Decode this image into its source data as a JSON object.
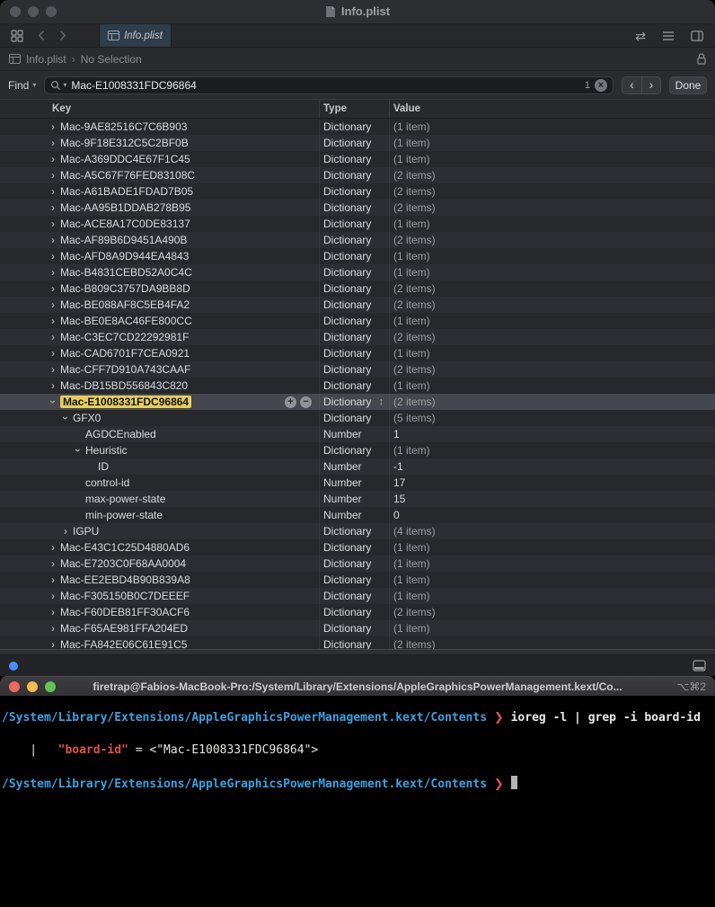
{
  "icons": {
    "disclosure": "›",
    "stepper": "↕",
    "clear": "×",
    "prev": "‹",
    "next": "›",
    "dropdown": "▾",
    "crumb_separator": "›",
    "swap_editors": "⇄",
    "add": "+",
    "remove": "−"
  },
  "colors": {
    "find_highlight": "#e6cd60",
    "selected_row": "#44484e",
    "terminal_path_blue": "#3da1e0",
    "terminal_red": "#de524d",
    "terminal_background": "#000000",
    "status_dot_blue": "#4d8df6"
  },
  "xcode": {
    "window_title": "Info.plist",
    "tab_title": "Info.plist",
    "jumpbar": {
      "file": "Info.plist",
      "selection": "No Selection"
    },
    "findbar": {
      "mode_label": "Find",
      "query": "Mac-E1008331FDC96864",
      "match_count": "1",
      "done_label": "Done"
    },
    "columns": {
      "key": "Key",
      "type": "Type",
      "value": "Value"
    },
    "rows": [
      {
        "key": "Mac-9AE82516C7C6B903",
        "type": "Dictionary",
        "value": "(1 item)",
        "indent": 0,
        "disclosure": "collapsed"
      },
      {
        "key": "Mac-9F18E312C5C2BF0B",
        "type": "Dictionary",
        "value": "(1 item)",
        "indent": 0,
        "disclosure": "collapsed"
      },
      {
        "key": "Mac-A369DDC4E67F1C45",
        "type": "Dictionary",
        "value": "(1 item)",
        "indent": 0,
        "disclosure": "collapsed"
      },
      {
        "key": "Mac-A5C67F76FED83108C",
        "type": "Dictionary",
        "value": "(2 items)",
        "indent": 0,
        "disclosure": "collapsed"
      },
      {
        "key": "Mac-A61BADE1FDAD7B05",
        "type": "Dictionary",
        "value": "(2 items)",
        "indent": 0,
        "disclosure": "collapsed"
      },
      {
        "key": "Mac-AA95B1DDAB278B95",
        "type": "Dictionary",
        "value": "(2 items)",
        "indent": 0,
        "disclosure": "collapsed"
      },
      {
        "key": "Mac-ACE8A17C0DE83137",
        "type": "Dictionary",
        "value": "(1 item)",
        "indent": 0,
        "disclosure": "collapsed"
      },
      {
        "key": "Mac-AF89B6D9451A490B",
        "type": "Dictionary",
        "value": "(2 items)",
        "indent": 0,
        "disclosure": "collapsed"
      },
      {
        "key": "Mac-AFD8A9D944EA4843",
        "type": "Dictionary",
        "value": "(1 item)",
        "indent": 0,
        "disclosure": "collapsed"
      },
      {
        "key": "Mac-B4831CEBD52A0C4C",
        "type": "Dictionary",
        "value": "(1 item)",
        "indent": 0,
        "disclosure": "collapsed"
      },
      {
        "key": "Mac-B809C3757DA9BB8D",
        "type": "Dictionary",
        "value": "(2 items)",
        "indent": 0,
        "disclosure": "collapsed"
      },
      {
        "key": "Mac-BE088AF8C5EB4FA2",
        "type": "Dictionary",
        "value": "(2 items)",
        "indent": 0,
        "disclosure": "collapsed"
      },
      {
        "key": "Mac-BE0E8AC46FE800CC",
        "type": "Dictionary",
        "value": "(1 item)",
        "indent": 0,
        "disclosure": "collapsed"
      },
      {
        "key": "Mac-C3EC7CD22292981F",
        "type": "Dictionary",
        "value": "(2 items)",
        "indent": 0,
        "disclosure": "collapsed"
      },
      {
        "key": "Mac-CAD6701F7CEA0921",
        "type": "Dictionary",
        "value": "(1 item)",
        "indent": 0,
        "disclosure": "collapsed"
      },
      {
        "key": "Mac-CFF7D910A743CAAF",
        "type": "Dictionary",
        "value": "(2 items)",
        "indent": 0,
        "disclosure": "collapsed"
      },
      {
        "key": "Mac-DB15BD556843C820",
        "type": "Dictionary",
        "value": "(1 item)",
        "indent": 0,
        "disclosure": "collapsed"
      },
      {
        "key": "Mac-E1008331FDC96864",
        "type": "Dictionary",
        "value": "(2 items)",
        "indent": 0,
        "disclosure": "expanded",
        "selected": true,
        "highlighted": true
      },
      {
        "key": "GFX0",
        "type": "Dictionary",
        "value": "(5 items)",
        "indent": 1,
        "disclosure": "expanded"
      },
      {
        "key": "AGDCEnabled",
        "type": "Number",
        "value": "1",
        "indent": 2,
        "disclosure": "none"
      },
      {
        "key": "Heuristic",
        "type": "Dictionary",
        "value": "(1 item)",
        "indent": 2,
        "disclosure": "expanded"
      },
      {
        "key": "ID",
        "type": "Number",
        "value": "-1",
        "indent": 3,
        "disclosure": "none"
      },
      {
        "key": "control-id",
        "type": "Number",
        "value": "17",
        "indent": 2,
        "disclosure": "none"
      },
      {
        "key": "max-power-state",
        "type": "Number",
        "value": "15",
        "indent": 2,
        "disclosure": "none"
      },
      {
        "key": "min-power-state",
        "type": "Number",
        "value": "0",
        "indent": 2,
        "disclosure": "none"
      },
      {
        "key": "IGPU",
        "type": "Dictionary",
        "value": "(4 items)",
        "indent": 1,
        "disclosure": "collapsed"
      },
      {
        "key": "Mac-E43C1C25D4880AD6",
        "type": "Dictionary",
        "value": "(1 item)",
        "indent": 0,
        "disclosure": "collapsed"
      },
      {
        "key": "Mac-E7203C0F68AA0004",
        "type": "Dictionary",
        "value": "(1 item)",
        "indent": 0,
        "disclosure": "collapsed"
      },
      {
        "key": "Mac-EE2EBD4B90B839A8",
        "type": "Dictionary",
        "value": "(1 item)",
        "indent": 0,
        "disclosure": "collapsed"
      },
      {
        "key": "Mac-F305150B0C7DEEEF",
        "type": "Dictionary",
        "value": "(1 item)",
        "indent": 0,
        "disclosure": "collapsed"
      },
      {
        "key": "Mac-F60DEB81FF30ACF6",
        "type": "Dictionary",
        "value": "(2 items)",
        "indent": 0,
        "disclosure": "collapsed"
      },
      {
        "key": "Mac-F65AE981FFA204ED",
        "type": "Dictionary",
        "value": "(1 item)",
        "indent": 0,
        "disclosure": "collapsed"
      },
      {
        "key": "Mac-FA842E06C61E91C5",
        "type": "Dictionary",
        "value": "(2 items)",
        "indent": 0,
        "disclosure": "collapsed"
      }
    ]
  },
  "terminal": {
    "title": "firetrap@Fabios-MacBook-Pro:/System/Library/Extensions/AppleGraphicsPowerManagement.kext/Co...",
    "shortcut": "⌥⌘2",
    "prompt_path": "/System/Library/Extensions/AppleGraphicsPowerManagement.kext/Contents",
    "prompt_symbol": "❯",
    "command": "ioreg -l | grep -i board-id",
    "output_prefix": "    |   ",
    "output_match": "\"board-id\"",
    "output_suffix": " = <\"Mac-E1008331FDC96864\">"
  }
}
